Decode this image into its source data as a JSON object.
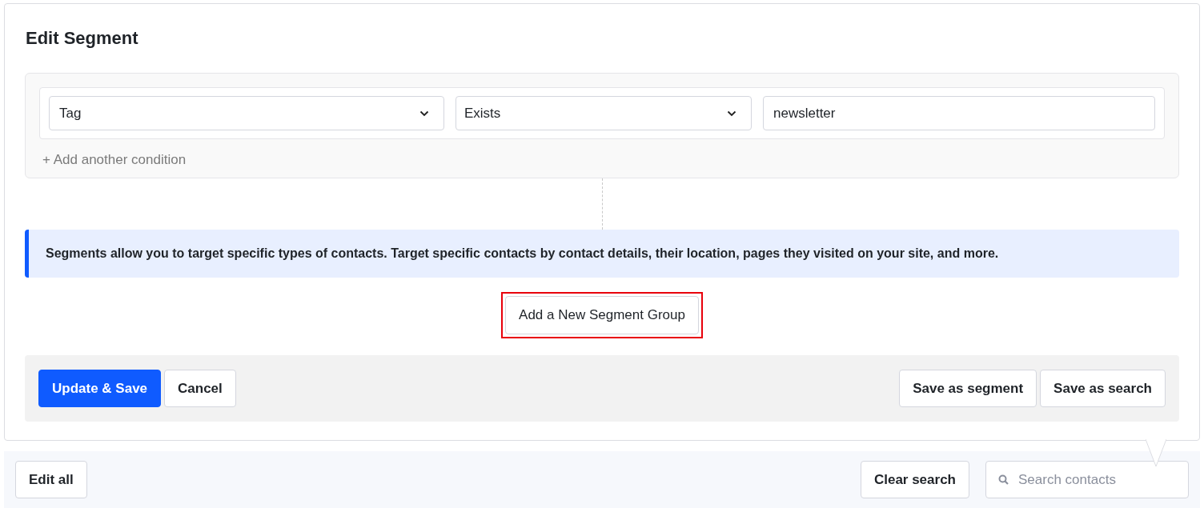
{
  "panel": {
    "title": "Edit Segment",
    "conditions": [
      {
        "field": "Tag",
        "operator": "Exists",
        "value": "newsletter"
      }
    ],
    "add_condition": "+ Add another condition",
    "info": "Segments allow you to target specific types of contacts. Target specific contacts by contact details, their location, pages they visited on your site, and more.",
    "add_group": {
      "label": "Add a New Segment Group",
      "highlighted": true
    },
    "actions_left": [
      {
        "label": "Update & Save",
        "kind": "primary"
      },
      {
        "label": "Cancel",
        "kind": "secondary"
      }
    ],
    "actions_right": [
      {
        "label": "Save as segment"
      },
      {
        "label": "Save as search"
      }
    ]
  },
  "toolbar": {
    "edit_all": "Edit all",
    "clear_search": "Clear search",
    "search": {
      "placeholder": "Search contacts"
    }
  }
}
